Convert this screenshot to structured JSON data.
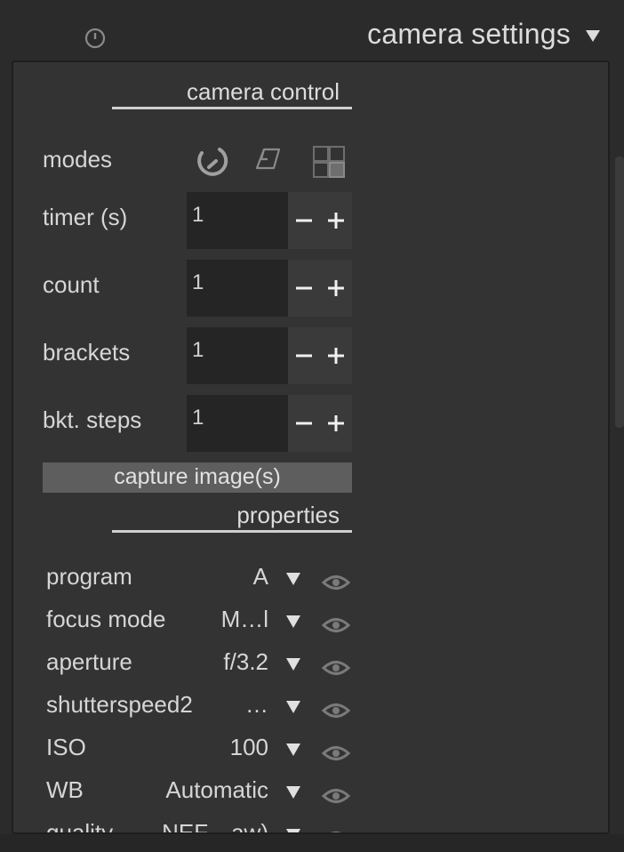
{
  "header": {
    "title": "camera settings",
    "icons": {
      "power": "power-icon",
      "expand": "triangle-down-icon"
    }
  },
  "camera_control": {
    "title": "camera control",
    "modes_label": "modes",
    "modes_icons": [
      "rotate-icon",
      "timelapse-icon",
      "bracket-grid-icon"
    ],
    "steppers": [
      {
        "label": "timer (s)",
        "value": "1"
      },
      {
        "label": "count",
        "value": "1"
      },
      {
        "label": "brackets",
        "value": "1"
      },
      {
        "label": "bkt. steps",
        "value": "1"
      }
    ],
    "stepper_minus": "−",
    "stepper_plus": "+",
    "capture_label": "capture image(s)"
  },
  "properties": {
    "title": "properties",
    "rows": [
      {
        "label": "program",
        "value": "A"
      },
      {
        "label": "focus mode",
        "value": "M…l"
      },
      {
        "label": "aperture",
        "value": "f/3.2"
      },
      {
        "label": "shutterspeed2",
        "value": "…"
      },
      {
        "label": "ISO",
        "value": "100"
      },
      {
        "label": "WB",
        "value": "Automatic"
      },
      {
        "label": "quality",
        "value": "NEF…aw)"
      }
    ]
  },
  "colors": {
    "background": "#2b2b2b",
    "panel": "#333333",
    "input": "#252525",
    "button": "#5e5e5e",
    "text": "#d6d6d6"
  }
}
